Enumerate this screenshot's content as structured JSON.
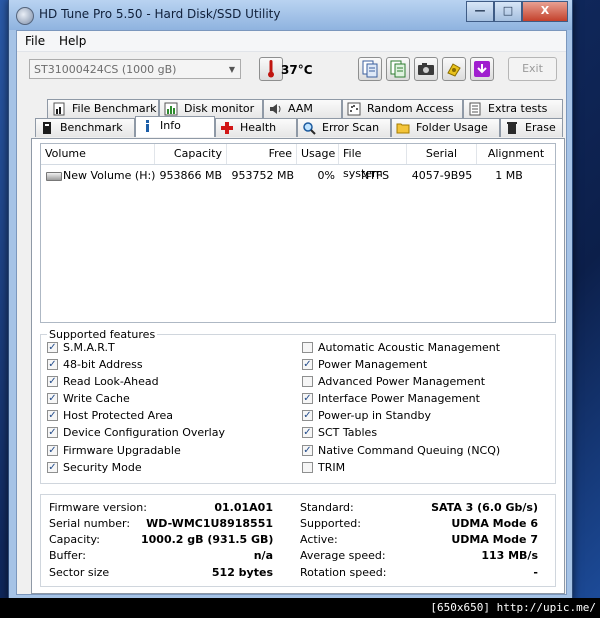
{
  "window": {
    "title": "HD Tune Pro 5.50 - Hard Disk/SSD Utility",
    "controls": {
      "minimize": "—",
      "maximize": "□",
      "close": "X"
    }
  },
  "menu": [
    "File",
    "Help"
  ],
  "toolbar": {
    "drive": "ST31000424CS (1000 gB)",
    "temperature": "37°C",
    "exit_label": "Exit",
    "icons": [
      "copy-text-icon",
      "copy-info-icon",
      "screenshot-camera-icon",
      "options-icon",
      "save-download-icon"
    ]
  },
  "tabs_row1": [
    "File Benchmark",
    "Disk monitor",
    "AAM",
    "Random Access",
    "Extra tests"
  ],
  "tabs_row2": [
    "Benchmark",
    "Info",
    "Health",
    "Error Scan",
    "Folder Usage",
    "Erase"
  ],
  "active_tab": "Info",
  "volumes": {
    "columns": [
      "Volume",
      "Capacity",
      "Free",
      "Usage",
      "File system",
      "Serial",
      "Alignment"
    ],
    "rows": [
      [
        "New Volume (H:)",
        "953866 MB",
        "953752 MB",
        "0%",
        "NTFS",
        "4057-9B95",
        "1 MB"
      ]
    ]
  },
  "features": {
    "title": "Supported features",
    "left": [
      {
        "label": "S.M.A.R.T",
        "checked": true
      },
      {
        "label": "48-bit Address",
        "checked": true
      },
      {
        "label": "Read Look-Ahead",
        "checked": true
      },
      {
        "label": "Write Cache",
        "checked": true
      },
      {
        "label": "Host Protected Area",
        "checked": true
      },
      {
        "label": "Device Configuration Overlay",
        "checked": true
      },
      {
        "label": "Firmware Upgradable",
        "checked": true
      },
      {
        "label": "Security Mode",
        "checked": true
      }
    ],
    "right": [
      {
        "label": "Automatic Acoustic Management",
        "checked": false
      },
      {
        "label": "Power Management",
        "checked": true
      },
      {
        "label": "Advanced Power Management",
        "checked": false
      },
      {
        "label": "Interface Power Management",
        "checked": true
      },
      {
        "label": "Power-up in Standby",
        "checked": true
      },
      {
        "label": "SCT Tables",
        "checked": true
      },
      {
        "label": "Native Command Queuing (NCQ)",
        "checked": true
      },
      {
        "label": "TRIM",
        "checked": false
      }
    ]
  },
  "info_left": [
    {
      "key": "Firmware version:",
      "value": "01.01A01"
    },
    {
      "key": "Serial number:",
      "value": "WD-WMC1U8918551"
    },
    {
      "key": "Capacity:",
      "value": "1000.2 gB (931.5 GB)"
    },
    {
      "key": "Buffer:",
      "value": "n/a"
    },
    {
      "key": "Sector size",
      "value": "512 bytes"
    }
  ],
  "info_right": [
    {
      "key": "Standard:",
      "value": "SATA 3 (6.0 Gb/s)"
    },
    {
      "key": "Supported:",
      "value": "UDMA Mode 6"
    },
    {
      "key": "Active:",
      "value": "UDMA Mode 7"
    },
    {
      "key": "Average speed:",
      "value": "113 MB/s"
    },
    {
      "key": "Rotation speed:",
      "value": "-"
    }
  ],
  "caption": "[650x650] http://upic.me/"
}
